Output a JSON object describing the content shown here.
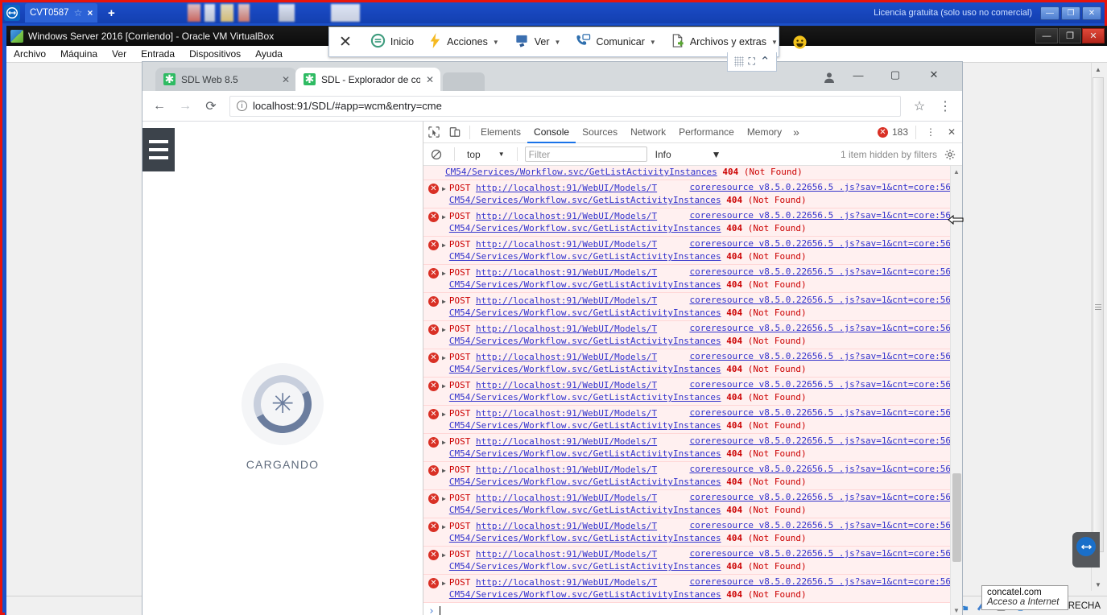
{
  "teamviewer": {
    "tab_label": "CVT0587",
    "star_icon": "star-icon",
    "close_icon": "×",
    "new_tab_icon": "+",
    "license_text": "Licencia gratuita (solo uso no comercial)",
    "window_buttons": {
      "minimize": "—",
      "maximize": "❐",
      "close": "✕"
    }
  },
  "virtualbox": {
    "title": "Windows Server 2016 [Corriendo] - Oracle VM VirtualBox",
    "menu": [
      "Archivo",
      "Máquina",
      "Ver",
      "Entrada",
      "Dispositivos",
      "Ayuda"
    ],
    "window_buttons": {
      "minimize": "—",
      "restore": "❐",
      "close": "✕"
    },
    "status_icons": [
      "disk-icon",
      "optical-disc-icon",
      "network-icon",
      "shared-folders-icon",
      "usb-icon",
      "display-icon",
      "mouse-integration-icon"
    ],
    "status_key": "DERECHA",
    "tooltip": {
      "line1": "concatel.com",
      "line2": "Acceso a Internet"
    }
  },
  "tv_toolbar": {
    "close_icon": "✕",
    "items": [
      {
        "label": "Inicio",
        "icon": "home-session-icon",
        "caret": false
      },
      {
        "label": "Acciones",
        "icon": "lightning-icon",
        "caret": true
      },
      {
        "label": "Ver",
        "icon": "monitor-icon",
        "caret": true
      },
      {
        "label": "Comunicar",
        "icon": "chat-phone-icon",
        "caret": true
      },
      {
        "label": "Archivos y extras",
        "icon": "file-extras-icon",
        "caret": true
      }
    ],
    "smiley_icon": "smiley-icon",
    "grip_icon": "grip-icon",
    "fullscreen_icon": "⛶",
    "collapse_icon": "⌃"
  },
  "chrome": {
    "tabs": [
      {
        "label": "SDL Web 8.5",
        "active": false,
        "favicon": "sdl-favicon",
        "close": "✕"
      },
      {
        "label": "SDL - Explorador de cont",
        "active": true,
        "favicon": "sdl-favicon",
        "close": "✕"
      }
    ],
    "nav": {
      "back": "←",
      "forward": "→",
      "reload": "⟳"
    },
    "omnibox": {
      "info_icon": "ⓘ",
      "url": "localhost:91/SDL/#app=wcm&entry=cme",
      "star": "☆",
      "menu": "⋮"
    },
    "window_buttons": {
      "account": "account-icon",
      "minimize": "—",
      "maximize": "▢",
      "close": "✕"
    }
  },
  "page": {
    "menu_icon": "hamburger-icon",
    "loader_glyph": "✳",
    "loading_text": "CARGANDO"
  },
  "devtools": {
    "inspect_icon": "inspect-cursor-icon",
    "device_icon": "device-toolbar-icon",
    "tabs": [
      "Elements",
      "Console",
      "Sources",
      "Network",
      "Performance",
      "Memory"
    ],
    "active_tab": "Console",
    "more_tabs_icon": "»",
    "error_count": "183",
    "kebab_icon": "⋮",
    "close_icon": "✕",
    "clear_icon": "🚫",
    "context": "top",
    "filter_placeholder": "Filter",
    "level": "Info",
    "hidden_note": "1 item hidden by filters",
    "settings_icon": "gear-icon",
    "prompt_chevron": "›",
    "prompt_value": "",
    "console": {
      "partial_top_line": "CM54/Services/Workflow.svc/GetListActivityInstances 404 (Not Found)",
      "entry_template": {
        "method": "POST",
        "url_line1": "http://localhost:91/WebUI/Models/T",
        "url_line2": "CM54/Services/Workflow.svc/GetListActivityInstances",
        "status": "404",
        "status_text": "(Not Found)",
        "source": "coreresource v8.5.0.22656.5 .js?sav=1&cnt=core:56",
        "expander": "▶",
        "icon": "error-icon"
      },
      "entry_count": 15
    }
  },
  "colors": {
    "error_red": "#d93025",
    "error_bg": "#fff0f0",
    "link_blue": "#3333cc",
    "accent_blue": "#1a73e8",
    "tv_blue": "#1b50c8",
    "border_red": "#e8140c",
    "sdl_green": "#2fbb63",
    "spinner_dark": "#6b7d9e",
    "spinner_light": "#c8cfdd"
  }
}
